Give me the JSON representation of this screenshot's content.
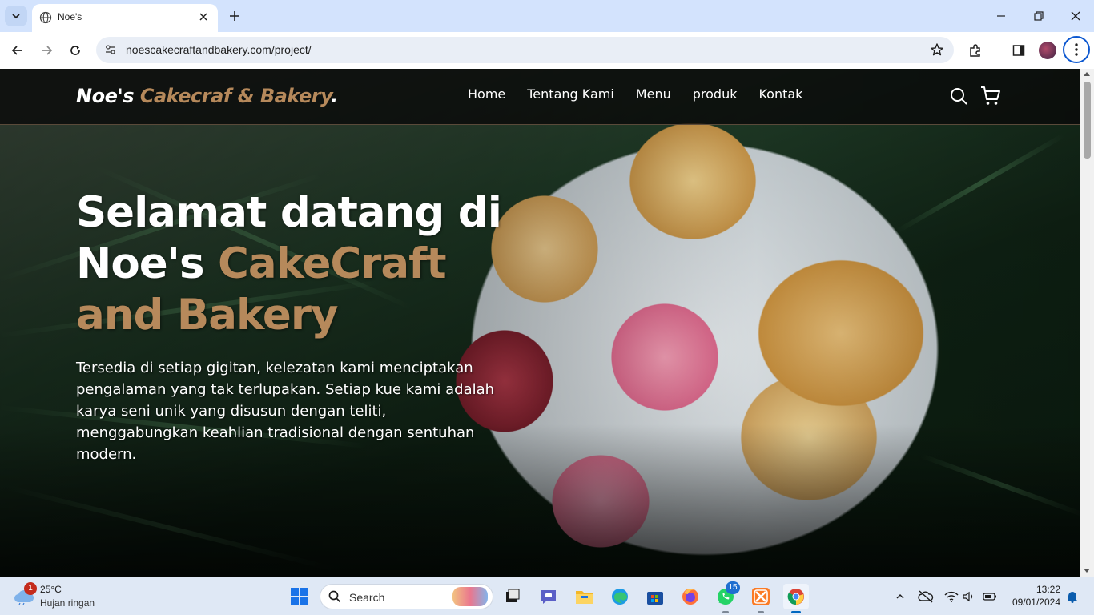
{
  "browser": {
    "tab_title": "Noe's",
    "url": "noescakecraftandbakery.com/project/"
  },
  "site": {
    "brand_main": "Noe's",
    "brand_accent": " Cakecraf & Bakery",
    "brand_dot": ".",
    "nav": [
      "Home",
      "Tentang Kami",
      "Menu",
      "produk",
      "Kontak"
    ],
    "accent_color": "#b6895b"
  },
  "hero": {
    "title_line1": "Selamat datang di",
    "title_line2_white": "Noe's ",
    "title_line2_accent": "CakeCraft",
    "title_line3_accent": "and Bakery",
    "description": "Tersedia di setiap gigitan, kelezatan kami menciptakan pengalaman yang tak terlupakan. Setiap kue kami adalah karya seni unik yang disusun dengan teliti, menggabungkan keahlian tradisional dengan sentuhan modern."
  },
  "taskbar": {
    "weather_temp": "25°C",
    "weather_condition": "Hujan ringan",
    "weather_badge": "1",
    "search_placeholder": "Search",
    "whatsapp_badge": "15",
    "time": "13:22",
    "date": "09/01/2024"
  }
}
